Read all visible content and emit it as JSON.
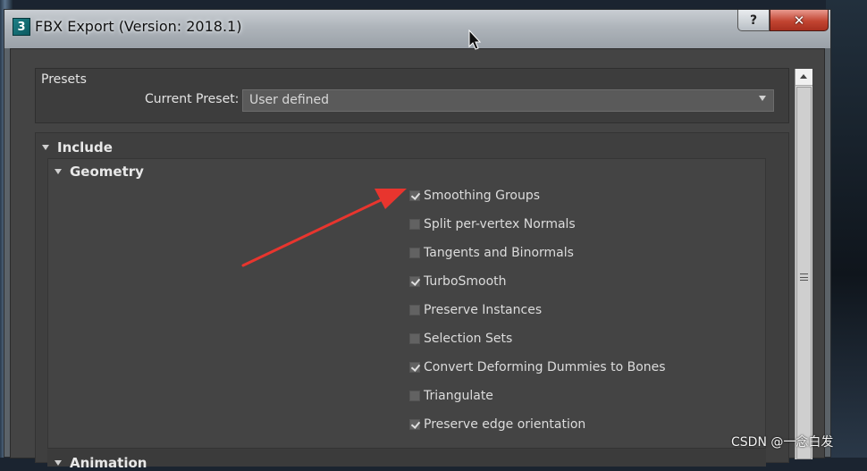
{
  "window": {
    "title": "FBX Export (Version: 2018.1)",
    "app_icon": "3",
    "help_label": "?",
    "close_label": "✕"
  },
  "presets": {
    "group_label": "Presets",
    "current_label": "Current Preset:",
    "value": "User defined"
  },
  "include": {
    "label": "Include",
    "geometry": {
      "label": "Geometry",
      "options": [
        {
          "label": "Smoothing Groups",
          "checked": true
        },
        {
          "label": "Split per-vertex Normals",
          "checked": false
        },
        {
          "label": "Tangents and Binormals",
          "checked": false
        },
        {
          "label": "TurboSmooth",
          "checked": true
        },
        {
          "label": "Preserve Instances",
          "checked": false
        },
        {
          "label": "Selection Sets",
          "checked": false
        },
        {
          "label": "Convert Deforming Dummies to Bones",
          "checked": true
        },
        {
          "label": "Triangulate",
          "checked": false
        },
        {
          "label": "Preserve edge orientation",
          "checked": true
        }
      ]
    },
    "animation_label": "Animation"
  },
  "watermark": "CSDN @一念白发",
  "colors": {
    "annotation_arrow": "#e8352e",
    "close_button": "#c24532"
  }
}
